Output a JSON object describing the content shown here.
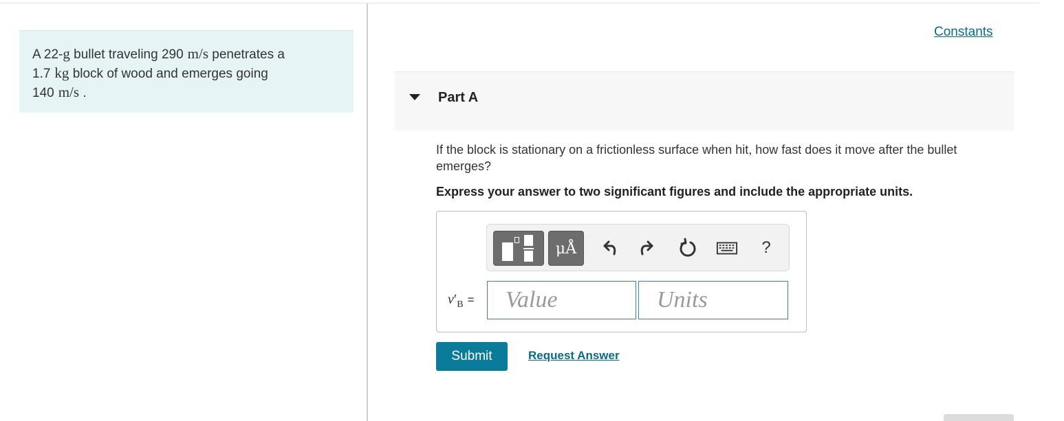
{
  "problem": {
    "t1": "A 22-",
    "m1": "g",
    "t2": " bullet traveling 290",
    "m2": "m/s",
    "t3": " penetrates a",
    "t4": "1.7",
    "m3": "kg",
    "t5": " block of wood and emerges going",
    "t6": "140",
    "m4": "m/s",
    "t7": " ."
  },
  "constants_link": "Constants",
  "part": {
    "title": "Part A",
    "question": "If the block is stationary on a frictionless surface when hit, how fast does it move after the bullet emerges?",
    "instruction": "Express your answer to two significant figures and include the appropriate units."
  },
  "toolbar": {
    "units_button_label": "μÅ",
    "help_label": "?"
  },
  "answer": {
    "variable": "v",
    "variable_prime": "′",
    "variable_sub": "B",
    "equals": "=",
    "value_placeholder": "Value",
    "units_placeholder": "Units"
  },
  "actions": {
    "submit_label": "Submit",
    "request_label": "Request Answer"
  },
  "colors": {
    "accent": "#0a7b99",
    "link": "#0a6b86",
    "problem_bg": "#e6f4f5"
  }
}
